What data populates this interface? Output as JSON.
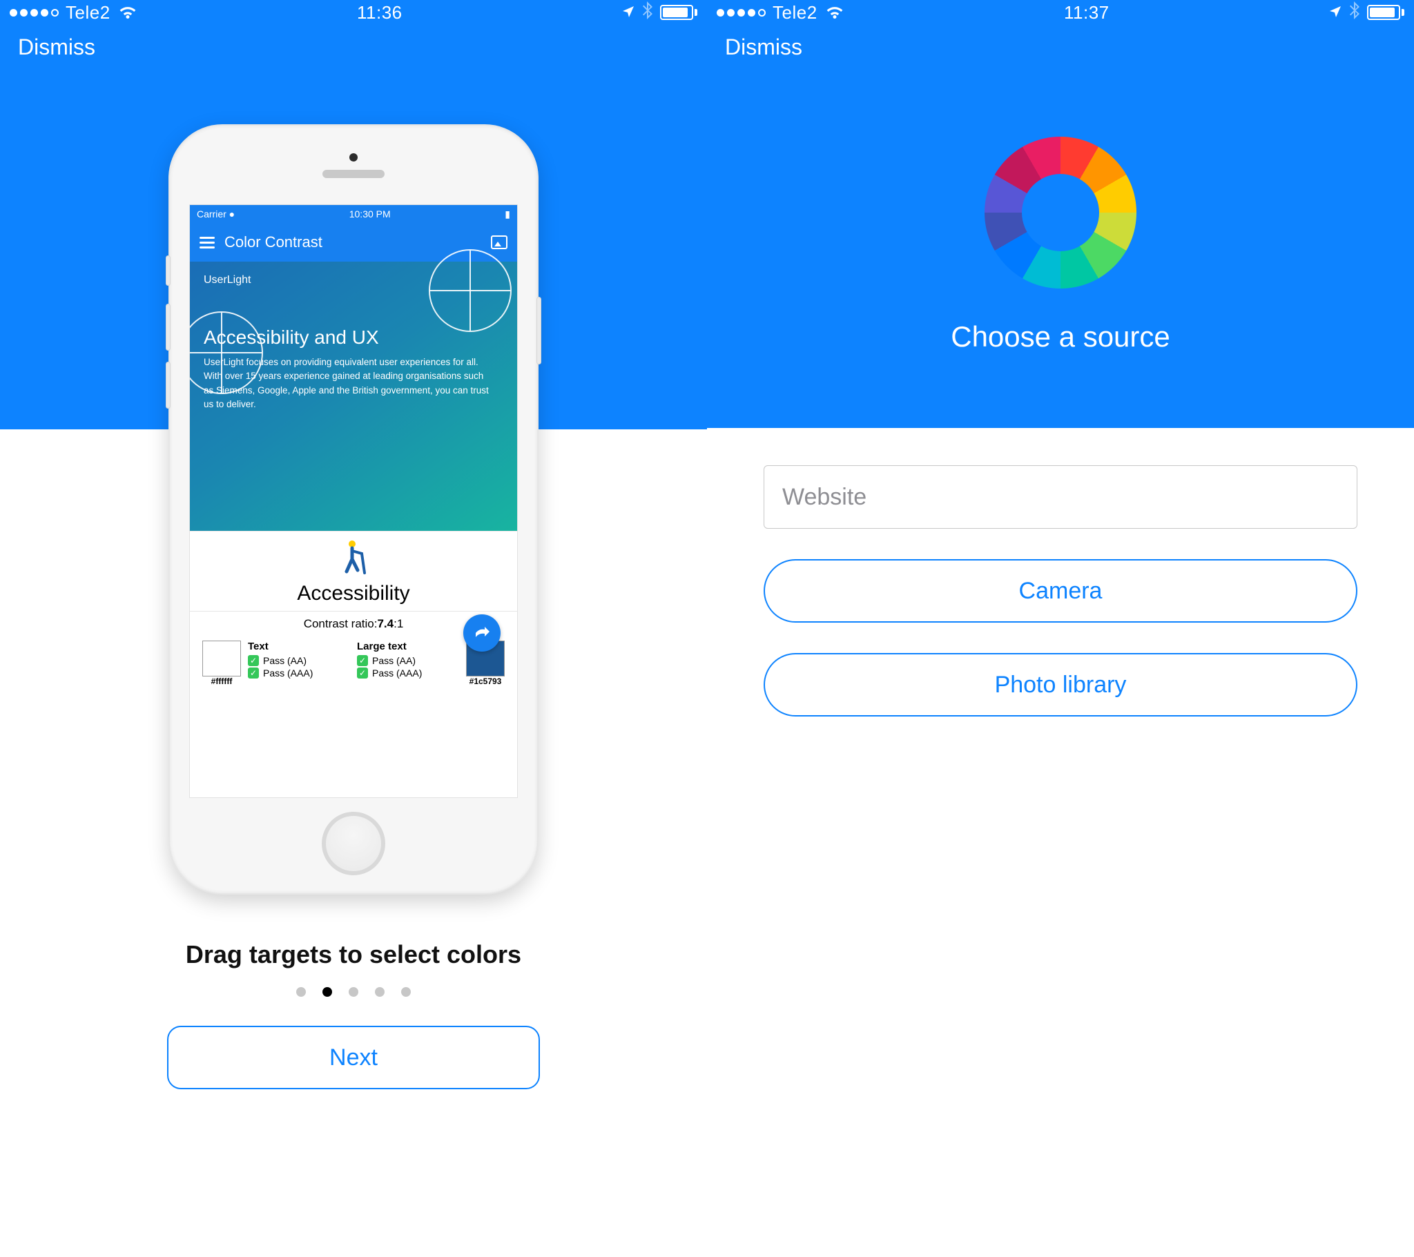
{
  "left": {
    "statusbar": {
      "carrier": "Tele2",
      "time": "11:36"
    },
    "dismiss": "Dismiss",
    "inner": {
      "status": {
        "carrier": "Carrier",
        "time": "10:30 PM"
      },
      "nav_title": "Color Contrast",
      "hero": {
        "brand": "UserLight",
        "heading": "Accessibility and UX",
        "body": "UserLight focuses on providing equivalent user experiences for all. With over 15 years experience gained at leading organisations such as Siemens, Google, Apple and the British government, you can trust us to deliver."
      },
      "results": {
        "heading": "Accessibility",
        "ratio_label": "Contrast ratio:",
        "ratio_value": "7.4",
        "ratio_suffix": ":1",
        "fg_hex": "#ffffff",
        "bg_hex": "#1c5793",
        "cols": {
          "text_hd": "Text",
          "large_hd": "Large text",
          "pass_aa": "Pass (AA)",
          "pass_aaa": "Pass (AAA)"
        }
      }
    },
    "caption": "Drag targets to select colors",
    "pager": {
      "count": 5,
      "active_index": 1
    },
    "next_label": "Next"
  },
  "right": {
    "statusbar": {
      "carrier": "Tele2",
      "time": "11:37"
    },
    "dismiss": "Dismiss",
    "title": "Choose a source",
    "website_placeholder": "Website",
    "camera_label": "Camera",
    "photo_label": "Photo library"
  },
  "colors": {
    "primary": "#0d83ff",
    "bg_swatch": "#1c5793"
  }
}
